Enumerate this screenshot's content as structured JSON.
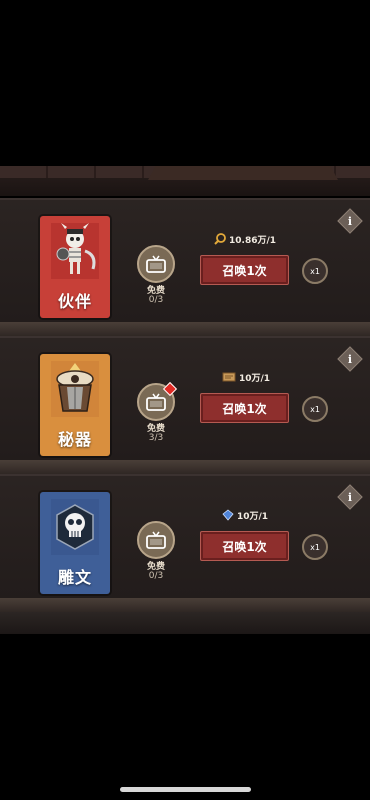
{
  "panels": [
    {
      "card_label": "伙伴",
      "card_color": "#c74038",
      "cost_text": "10.86万/1",
      "cost_icon": "magnifier-coin-icon",
      "free_label": "免费",
      "free_count": "0/3",
      "summon_label": "召唤1次",
      "multiplier": "x1",
      "has_notification": false
    },
    {
      "card_label": "秘器",
      "card_color": "#d98f3e",
      "cost_text": "10万/1",
      "cost_icon": "scroll-ticket-icon",
      "free_label": "免费",
      "free_count": "3/3",
      "summon_label": "召唤1次",
      "multiplier": "x1",
      "has_notification": true
    },
    {
      "card_label": "雕文",
      "card_color": "#3f5f98",
      "cost_text": "10万/1",
      "cost_icon": "blue-gem-icon",
      "free_label": "免费",
      "free_count": "0/3",
      "summon_label": "召唤1次",
      "multiplier": "x1",
      "has_notification": false
    }
  ],
  "info_glyph": "i"
}
